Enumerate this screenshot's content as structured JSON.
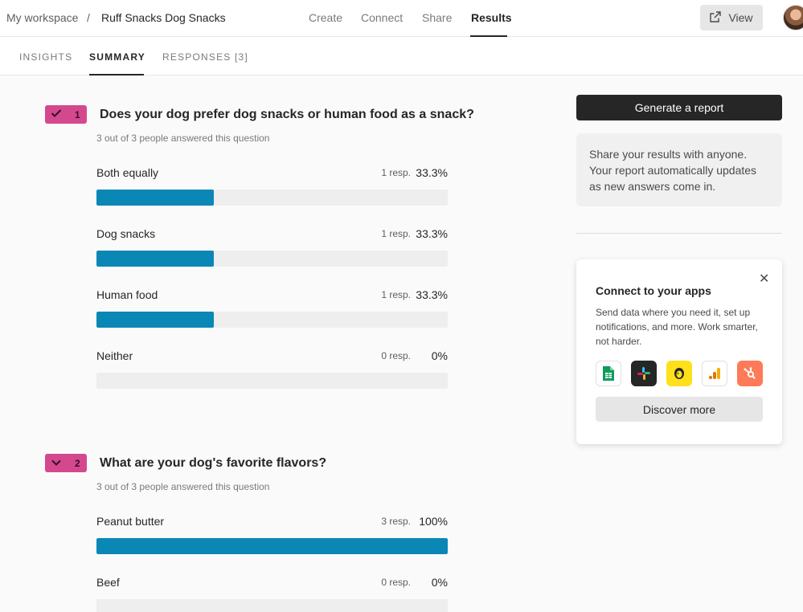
{
  "breadcrumb": {
    "workspace": "My workspace",
    "separator": "/",
    "form": "Ruff Snacks Dog Snacks"
  },
  "nav": {
    "create": "Create",
    "connect": "Connect",
    "share": "Share",
    "results": "Results"
  },
  "view_button": {
    "label": "View",
    "icon": "external-link-icon"
  },
  "subtabs": {
    "insights": "INSIGHTS",
    "summary": "SUMMARY",
    "responses": "RESPONSES [3]"
  },
  "questions": [
    {
      "number": "1",
      "icon": "check-icon",
      "title": "Does your dog prefer dog snacks or human food as a snack?",
      "answered": "3 out of 3 people answered this question",
      "options": [
        {
          "label": "Both equally",
          "resp": "1 resp.",
          "pct": "33.3%",
          "fraction": 0.333
        },
        {
          "label": "Dog snacks",
          "resp": "1 resp.",
          "pct": "33.3%",
          "fraction": 0.333
        },
        {
          "label": "Human food",
          "resp": "1 resp.",
          "pct": "33.3%",
          "fraction": 0.333
        },
        {
          "label": "Neither",
          "resp": "0 resp.",
          "pct": "0%",
          "fraction": 0
        }
      ]
    },
    {
      "number": "2",
      "icon": "chevron-down-icon",
      "title": "What are your dog's favorite flavors?",
      "answered": "3 out of 3 people answered this question",
      "options": [
        {
          "label": "Peanut butter",
          "resp": "3 resp.",
          "pct": "100%",
          "fraction": 1
        },
        {
          "label": "Beef",
          "resp": "0 resp.",
          "pct": "0%",
          "fraction": 0
        }
      ]
    }
  ],
  "report": {
    "button": "Generate a report",
    "share_text": "Share your results with anyone. Your report automatically updates as new answers come in."
  },
  "apps": {
    "title": "Connect to your apps",
    "description": "Send data where you need it, set up notifications, and more. Work smarter, not harder.",
    "icons": [
      "google-sheets-icon",
      "slack-icon",
      "mailchimp-icon",
      "google-analytics-icon",
      "hubspot-icon"
    ],
    "discover": "Discover more"
  },
  "colors": {
    "bar": "#0a87b5",
    "badge": "#d4488e",
    "dark": "#262627"
  }
}
